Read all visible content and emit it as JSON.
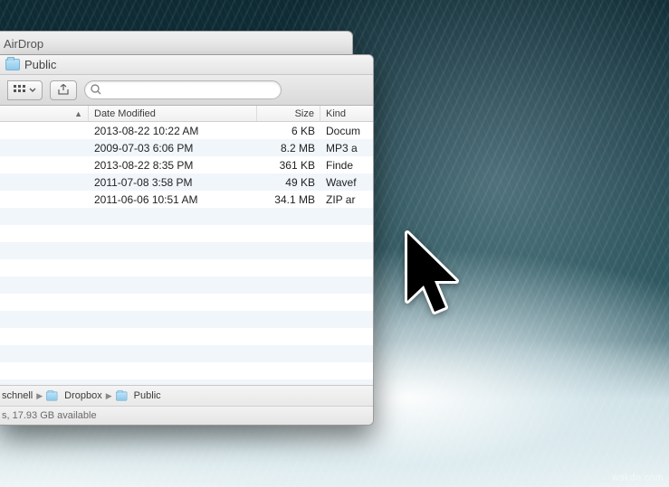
{
  "background_window": {
    "title": "AirDrop"
  },
  "finder": {
    "title": "Public",
    "search": {
      "placeholder": ""
    },
    "columns": {
      "name": "",
      "date": "Date Modified",
      "size": "Size",
      "kind": "Kind"
    },
    "rows": [
      {
        "date": "2013-08-22 10:22 AM",
        "size": "6 KB",
        "kind": "Docum"
      },
      {
        "date": "2009-07-03 6:06 PM",
        "size": "8.2 MB",
        "kind": "MP3 a"
      },
      {
        "date": "2013-08-22 8:35 PM",
        "size": "361 KB",
        "kind": "Finde"
      },
      {
        "date": "2011-07-08 3:58 PM",
        "size": "49 KB",
        "kind": "Wavef"
      },
      {
        "date": "2011-06-06 10:51 AM",
        "size": "34.1 MB",
        "kind": "ZIP ar"
      }
    ],
    "path": [
      {
        "label": "schnell",
        "is_first_fragment": true
      },
      {
        "label": "Dropbox"
      },
      {
        "label": "Public"
      }
    ],
    "status": "s, 17.93 GB available"
  },
  "watermark": "wskdn.com"
}
